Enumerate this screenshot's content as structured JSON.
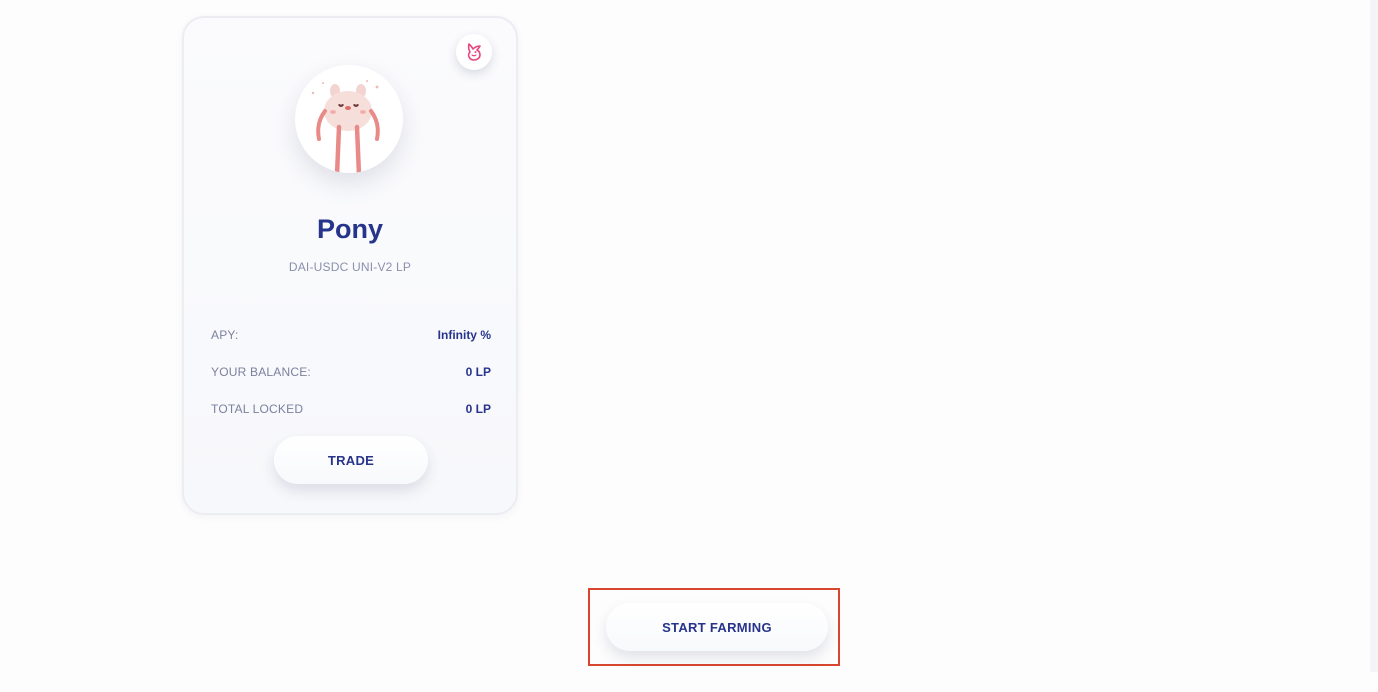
{
  "farm_card": {
    "platform_icon": "uniswap-unicorn-icon",
    "mascot_icon": "pony-mascot-icon",
    "title": "Pony",
    "token_pair": "DAI-USDC UNI-V2 LP",
    "stats": [
      {
        "label": "APY:",
        "value": "Infinity %"
      },
      {
        "label": "YOUR BALANCE:",
        "value": "0 LP"
      },
      {
        "label": "TOTAL LOCKED",
        "value": "0 LP"
      }
    ],
    "trade_label": "TRADE"
  },
  "start_farming_label": "START FARMING",
  "colors": {
    "text_primary": "#27348b",
    "text_muted": "#7b819e",
    "highlight": "#d9462f",
    "unicorn_pink": "#e8457f",
    "mascot_pink": "#e88a87"
  }
}
